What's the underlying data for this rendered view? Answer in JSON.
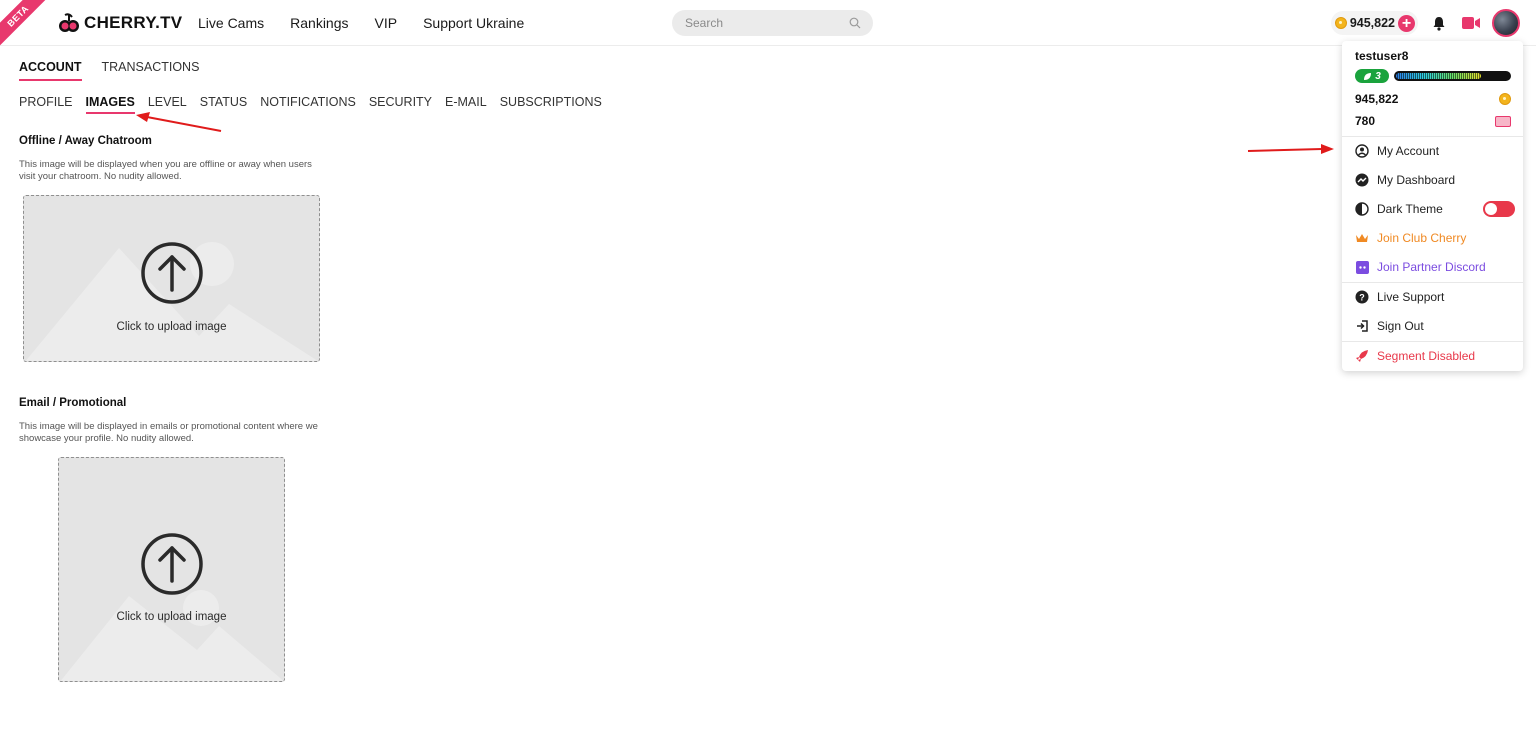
{
  "header": {
    "badge": "BETA",
    "logo_text": "CHERRY.TV",
    "nav": [
      "Live Cams",
      "Rankings",
      "VIP",
      "Support Ukraine"
    ],
    "search_placeholder": "Search",
    "balance": "945,822"
  },
  "tabs": {
    "main": [
      "ACCOUNT",
      "TRANSACTIONS"
    ],
    "main_active": "ACCOUNT",
    "sub": [
      "PROFILE",
      "IMAGES",
      "LEVEL",
      "STATUS",
      "NOTIFICATIONS",
      "SECURITY",
      "E-MAIL",
      "SUBSCRIPTIONS"
    ],
    "sub_active": "IMAGES"
  },
  "sections": [
    {
      "title": "Offline / Away Chatroom",
      "description": "This image will be displayed when you are offline or away when users visit your chatroom. No nudity allowed.",
      "upload_label": "Click to upload image"
    },
    {
      "title": "Email / Promotional",
      "description": "This image will be displayed in emails or promotional content where we showcase your profile. No nudity allowed.",
      "upload_label": "Click to upload image"
    }
  ],
  "dropdown": {
    "username": "testuser8",
    "level": "3",
    "level_progress": 0.75,
    "coins": "945,822",
    "tickets": "780",
    "items": [
      {
        "label": "My Account",
        "icon": "user-circle-icon",
        "color": "#222222"
      },
      {
        "label": "My Dashboard",
        "icon": "dashboard-icon",
        "color": "#222222"
      },
      {
        "label": "Dark Theme",
        "icon": "half-circle-icon",
        "color": "#222222"
      },
      {
        "label": "Join Club Cherry",
        "icon": "crown-icon",
        "color": "#f08a24"
      },
      {
        "label": "Join Partner Discord",
        "icon": "discord-icon",
        "color": "#7b4ce0"
      },
      {
        "label": "Live Support",
        "icon": "help-circle-icon",
        "color": "#222222"
      },
      {
        "label": "Sign Out",
        "icon": "sign-out-icon",
        "color": "#222222"
      },
      {
        "label": "Segment Disabled",
        "icon": "rocket-icon",
        "color": "#e8384a"
      }
    ]
  },
  "colors": {
    "accent": "#e8386d",
    "annotation_arrow": "#e01b1b"
  }
}
